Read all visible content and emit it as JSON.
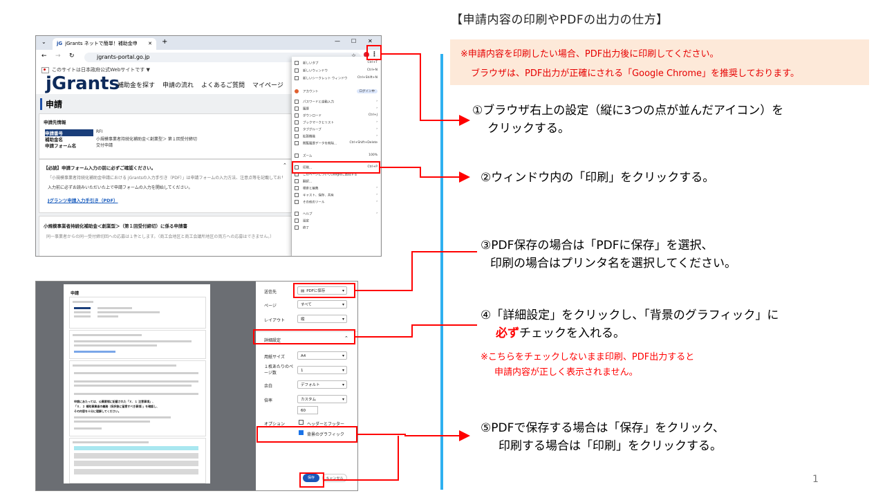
{
  "title": "【申請内容の印刷やPDFの出力の仕方】",
  "notice": {
    "line1": "※申請内容を印刷したい場合、PDF出力後に印刷してください。",
    "line2": "ブラウザは、PDF出力が正確にされる「Google Chrome」を推奨しております。"
  },
  "steps": {
    "s1_l1": "①ブラウザ右上の設定（縦に3つの点が並んだアイコン）を",
    "s1_l2": "クリックする。",
    "s2": "②ウィンドウ内の「印刷」をクリックする。",
    "s3_l1": "③PDF保存の場合は「PDFに保存」を選択、",
    "s3_l2": "印刷の場合はプリンタ名を選択してください。",
    "s4_l1": "④「詳細設定」をクリックし、「背景のグラフィック」に",
    "s4_em": "必ず",
    "s4_l2": "チェックを入れる。",
    "s4_warn1": "※こちらをチェックしないまま印刷、PDF出力すると",
    "s4_warn2": "申請内容が正しく表示されません。",
    "s5_l1": "⑤PDFで保存する場合は「保存」をクリック、",
    "s5_l2": "印刷する場合は「印刷」をクリックする。"
  },
  "page_number": "1",
  "browser": {
    "tab_title": "jGrants ネットで簡単！補助金申",
    "url": "jgrants-portal.go.jp",
    "gov_notice": "このサイトは日本政府公式Webサイトです ▼",
    "logo": "jGrants",
    "nav": [
      "補助金を探す",
      "申請の流れ",
      "よくあるご質問",
      "マイページ"
    ],
    "heading": "申請",
    "info_title": "申請先情報",
    "info_rows": [
      {
        "label": "申請番号",
        "value": "RFI"
      },
      {
        "label": "補助金名",
        "value": "小規模事業者持続化補助金＜創業型＞ 第１回受付締切"
      },
      {
        "label": "申請フォーム名",
        "value": "交付申請"
      }
    ],
    "must_title": "【必読】申請フォーム入力の前に必ずご確認ください。",
    "must_text1": "「小規模事業者持続化補助金申請における jGrantsの入力手引き（PDF）」は申請フォームの入力方法、注意点等を記載しております。",
    "must_text2": "入力前に必ずお読みいただいた上で申請フォームの入力を開始してください。",
    "must_link": "Jグランツ申請入力手引き（PDF）",
    "section2_title": "小規模事業者持続化補助金＜創業型＞（第１回受付締切）に係る申請書",
    "section2_text": "同一事業者からの同一受付締切回への応募は１件とします。（商工会地区と商工会議所地区の両方への応募はできません。）",
    "menu_items": [
      "新しいタブ",
      "新しいウィンドウ",
      "新しいシークレット ウィンドウ",
      "アカウント",
      "パスワードと自動入力",
      "履歴",
      "ダウンロード",
      "ブックマークとリスト",
      "タブグループ",
      "拡張機能",
      "閲覧履歴データを削除...",
      "ズーム",
      "印刷...",
      "このページについてGoogleに質問する",
      "翻訳...",
      "検索と編集",
      "キャスト、保存、共有",
      "その他のツール",
      "ヘルプ",
      "設定",
      "終了"
    ],
    "menu_shortcuts": {
      "new_tab": "Ctrl+T",
      "new_window": "Ctrl+N",
      "incognito": "Ctrl+Shift+N",
      "login": "ログイン中",
      "download": "Ctrl+J",
      "clear": "Ctrl+Shift+Delete",
      "zoom": "100%",
      "print": "Ctrl+P"
    }
  },
  "print_dialog": {
    "dest_label": "送信先",
    "dest_value": "PDFに保存",
    "pages_label": "ページ",
    "pages_value": "すべて",
    "layout_label": "レイアウト",
    "layout_value": "縦",
    "advanced_label": "詳細設定",
    "paper_label": "用紙サイズ",
    "paper_value": "A4",
    "pps_label": "１枚あたりのページ数",
    "pps_value": "1",
    "margin_label": "余白",
    "margin_value": "デフォルト",
    "scale_label": "倍率",
    "scale_value": "カスタム",
    "scale_num": "60",
    "options_label": "オプション",
    "opt_header": "ヘッダーとフッター",
    "opt_background": "背景のグラフィック",
    "save_button": "保存",
    "cancel_button": "キャンセル",
    "preview_heading": "申請",
    "preview_bold1": "申請にあたっては、公募要領に記載された「Ｘ．１ 注意事項」、",
    "preview_bold2": "「Ｘ．２ 補助事業者の義務（採択後に留意すべき事項）」を確認し、",
    "preview_bold3": "その内容を十分に理解してください。"
  }
}
